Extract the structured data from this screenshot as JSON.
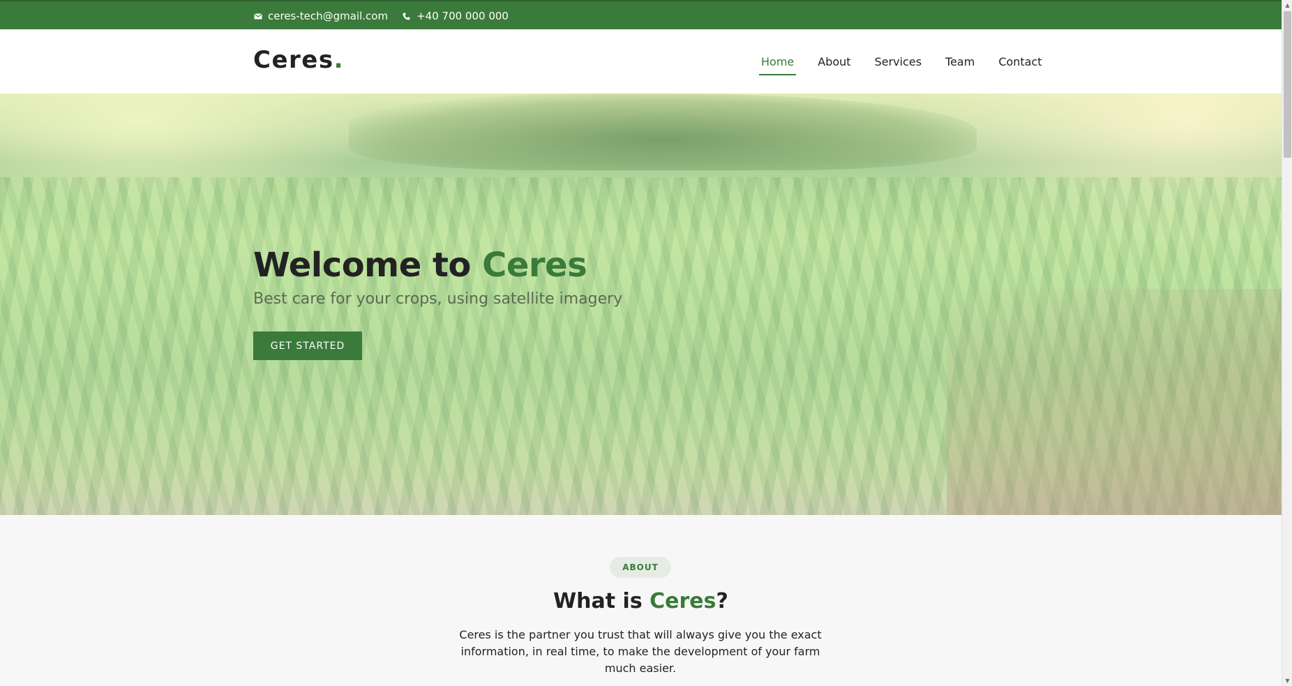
{
  "topbar": {
    "email": "ceres-tech@gmail.com",
    "email_icon": "envelope-icon",
    "phone": "+40 700 000 000",
    "phone_icon": "phone-icon",
    "bg_color": "#3a7a3a"
  },
  "header": {
    "logo_text": "Ceres",
    "logo_dot": ".",
    "nav": [
      {
        "label": "Home",
        "active": true
      },
      {
        "label": "About",
        "active": false
      },
      {
        "label": "Services",
        "active": false
      },
      {
        "label": "Team",
        "active": false
      },
      {
        "label": "Contact",
        "active": false
      }
    ]
  },
  "hero": {
    "title_prefix": "Welcome to ",
    "title_highlight": "Ceres",
    "subtitle": "Best care for your crops, using satellite imagery",
    "cta_label": "GET STARTED",
    "background": "cornfield-photo"
  },
  "about": {
    "badge": "ABOUT",
    "title_prefix": "What is ",
    "title_highlight": "Ceres",
    "title_suffix": "?",
    "text": "Ceres is the partner you trust that will always give you the exact information, in real time, to make the development of your farm much easier."
  },
  "colors": {
    "accent": "#3a7a3a",
    "text": "#222222"
  }
}
